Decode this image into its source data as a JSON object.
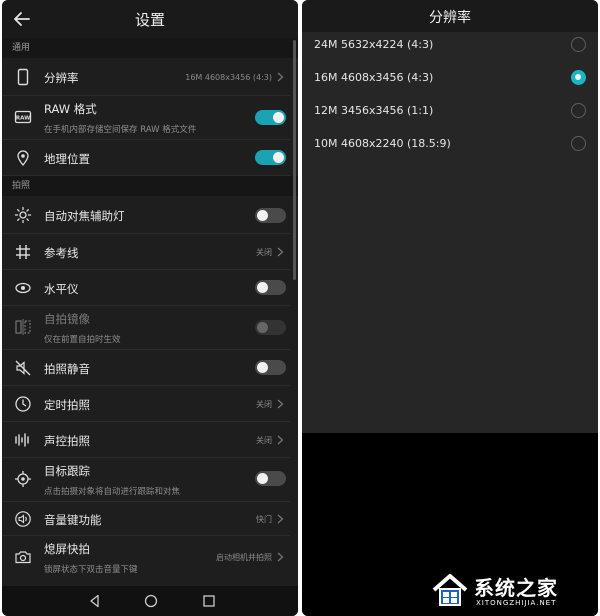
{
  "left": {
    "title": "设置",
    "sections": {
      "general": "通用",
      "photo": "拍照"
    },
    "rows": {
      "resolution": {
        "label": "分辨率",
        "value": "16M 4608x3456 (4:3)"
      },
      "raw": {
        "label": "RAW 格式",
        "sub": "在手机内部存储空间保存 RAW 格式文件",
        "toggle": "on"
      },
      "location": {
        "label": "地理位置",
        "toggle": "on"
      },
      "af_light": {
        "label": "自动对焦辅助灯",
        "toggle": "off"
      },
      "grid": {
        "label": "参考线",
        "value": "关闭"
      },
      "level": {
        "label": "水平仪",
        "toggle": "off"
      },
      "mirror": {
        "label": "自拍镜像",
        "sub": "仅在前置自拍时生效",
        "toggle": "disabled"
      },
      "mute": {
        "label": "拍照静音",
        "toggle": "off"
      },
      "timer": {
        "label": "定时拍照",
        "value": "关闭"
      },
      "voice": {
        "label": "声控拍照",
        "value": "关闭"
      },
      "tracking": {
        "label": "目标跟踪",
        "sub": "点击拍摄对象将自动进行跟踪和对焦",
        "toggle": "off"
      },
      "volume_key": {
        "label": "音量键功能",
        "value": "快门"
      },
      "quick_snap": {
        "label": "熄屏快拍",
        "sub": "锁屏状态下双击音量下键",
        "value": "启动相机并拍照"
      }
    }
  },
  "right": {
    "title": "分辨率",
    "options": [
      {
        "label": "24M 5632x4224 (4:3)",
        "selected": false
      },
      {
        "label": "16M 4608x3456 (4:3)",
        "selected": true
      },
      {
        "label": "12M 3456x3456 (1:1)",
        "selected": false
      },
      {
        "label": "10M 4608x2240 (18.5:9)",
        "selected": false
      }
    ]
  },
  "watermark": {
    "brand": "系统之家",
    "url": "XITONGZHIJIA.NET"
  },
  "colors": {
    "accent": "#1ba3b3",
    "background": "#1e1e1e"
  }
}
